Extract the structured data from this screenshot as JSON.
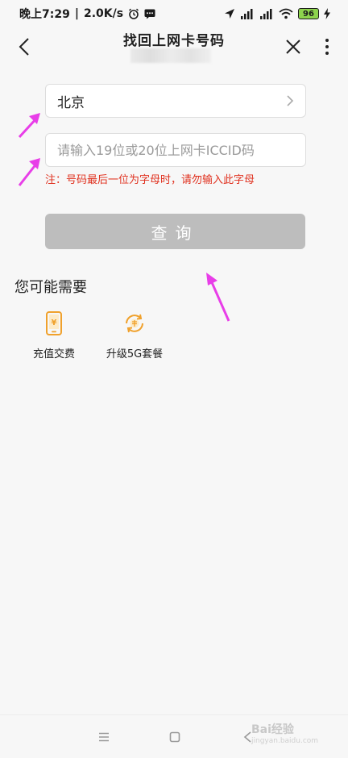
{
  "status_bar": {
    "time": "晚上7:29",
    "network_speed": "2.0K/s",
    "battery": "96"
  },
  "nav": {
    "title": "找回上网卡号码"
  },
  "form": {
    "region_value": "北京",
    "iccid_placeholder": "请输入19位或20位上网卡ICCID码",
    "iccid_value": "",
    "note": "注：号码最后一位为字母时，请勿输入此字母",
    "query_label": "查询"
  },
  "suggestions": {
    "title": "您可能需要",
    "items": [
      {
        "label": "充值交费",
        "icon": "phone-yuan-icon"
      },
      {
        "label": "升级5G套餐",
        "icon": "package-upgrade-icon"
      }
    ]
  },
  "watermark": {
    "text": "Bai经验",
    "sub": "jingyan.baidu.com"
  },
  "colors": {
    "accent_orange": "#f0a12c",
    "note_red": "#e0301e",
    "button_disabled": "#bdbdbd",
    "arrow_magenta": "#e83ee8"
  }
}
